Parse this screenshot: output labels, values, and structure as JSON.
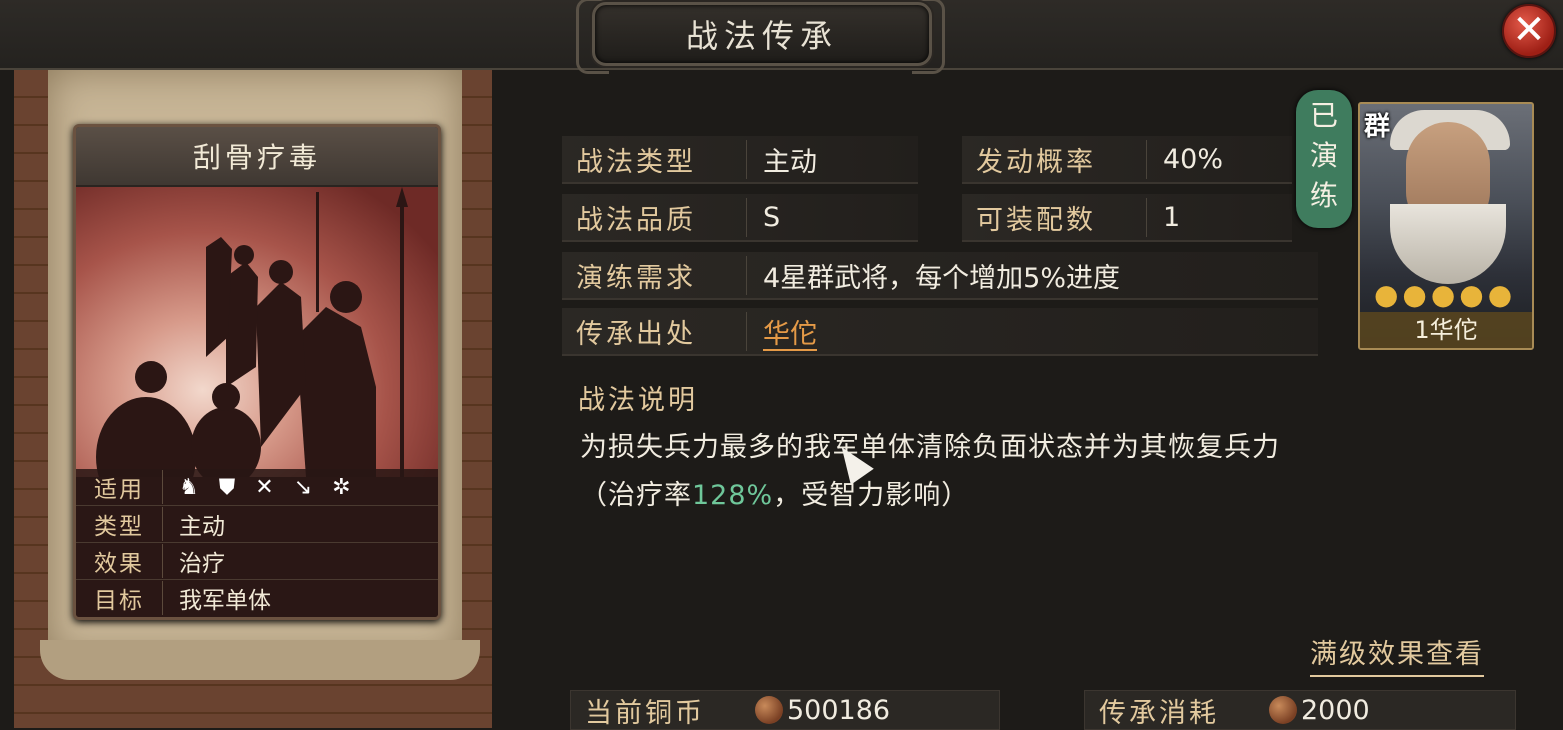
{
  "window": {
    "title": "战法传承",
    "close_icon": "close-icon"
  },
  "card": {
    "name": "刮骨疗毒",
    "stats": [
      {
        "key": "适用",
        "value": "",
        "icons": [
          "cavalry-icon",
          "shield-icon",
          "bow-icon",
          "spear-icon",
          "wheel-icon"
        ]
      },
      {
        "key": "类型",
        "value": "主动"
      },
      {
        "key": "效果",
        "value": "治疗"
      },
      {
        "key": "目标",
        "value": "我军单体"
      }
    ]
  },
  "info": {
    "type_label": "战法类型",
    "type_value": "主动",
    "prob_label": "发动概率",
    "prob_value": "40%",
    "quality_label": "战法品质",
    "quality_value": "S",
    "slots_label": "可装配数",
    "slots_value": "1",
    "req_label": "演练需求",
    "req_value": "4星群武将，每个增加5%进度",
    "source_label": "传承出处",
    "source_value": "华佗"
  },
  "description": {
    "title": "战法说明",
    "line1": "为损失兵力最多的我军单体清除负面状态并为其恢复兵力",
    "line2_pre": "（治疗率",
    "line2_rate": "128%",
    "line2_post": "，受智力影响）"
  },
  "view_full_label": "满级效果查看",
  "bottom": {
    "coins_label": "当前铜币",
    "coins_value": "500186",
    "cost_label": "传承消耗",
    "cost_value": "2000"
  },
  "general": {
    "badge": "已演练",
    "faction": "群",
    "stars": "●●●●●",
    "name": "1华佗"
  },
  "colors": {
    "accent_gold": "#e2c99e",
    "link": "#e59a47",
    "rate_green": "#6fc79a",
    "badge_green": "#3f7c5e",
    "close_red": "#c23a2e"
  }
}
